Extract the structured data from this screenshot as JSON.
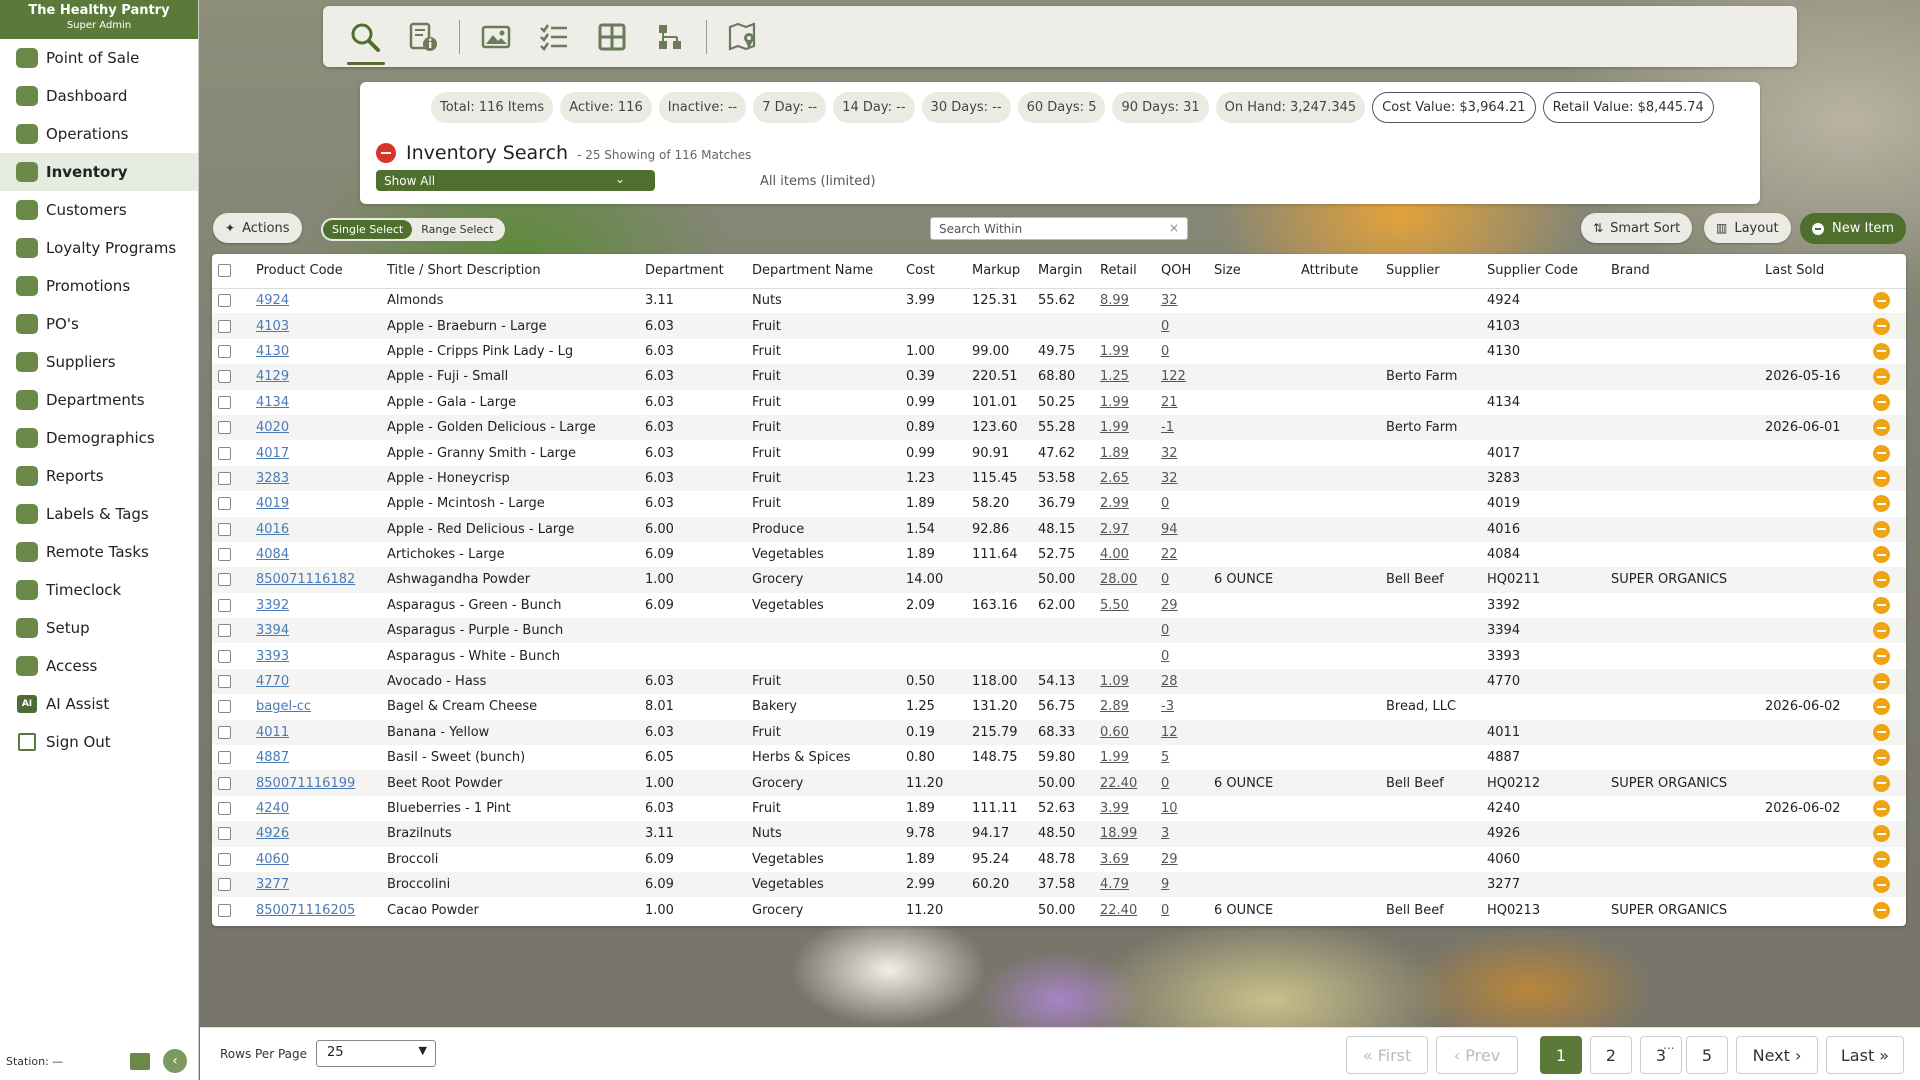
{
  "app": {
    "name": "The Healthy Pantry",
    "role": "Super Admin"
  },
  "sidebar": {
    "items": [
      {
        "label": "Point of Sale",
        "icon": "register-icon"
      },
      {
        "label": "Dashboard",
        "icon": "gauge-icon"
      },
      {
        "label": "Operations",
        "icon": "gears-icon"
      },
      {
        "label": "Inventory",
        "icon": "boxes-icon",
        "active": true
      },
      {
        "label": "Customers",
        "icon": "people-icon"
      },
      {
        "label": "Loyalty Programs",
        "icon": "badge-icon"
      },
      {
        "label": "Promotions",
        "icon": "megaphone-icon"
      },
      {
        "label": "PO's",
        "icon": "dollar-doc-icon"
      },
      {
        "label": "Suppliers",
        "icon": "truck-icon"
      },
      {
        "label": "Departments",
        "icon": "layers-icon"
      },
      {
        "label": "Demographics",
        "icon": "map-pin-icon"
      },
      {
        "label": "Reports",
        "icon": "bar-chart-icon"
      },
      {
        "label": "Labels & Tags",
        "icon": "tags-icon"
      },
      {
        "label": "Remote Tasks",
        "icon": "tablet-icon"
      },
      {
        "label": "Timeclock",
        "icon": "clock-icon"
      },
      {
        "label": "Setup",
        "icon": "sliders-icon"
      },
      {
        "label": "Access",
        "icon": "user-shield-icon"
      },
      {
        "label": "AI Assist",
        "icon": "ai-icon"
      },
      {
        "label": "Sign Out",
        "icon": "sign-out-icon"
      }
    ],
    "station": "Station: —"
  },
  "toolbar": {
    "buttons": [
      "search-icon",
      "item-info-icon",
      "image-icon",
      "checklist-icon",
      "grid-icon",
      "hierarchy-icon",
      "map-icon"
    ]
  },
  "summary": {
    "chips": [
      {
        "label": "Total: 116 Items"
      },
      {
        "label": "Active: 116"
      },
      {
        "label": "Inactive: --"
      },
      {
        "label": "7 Day: --"
      },
      {
        "label": "14 Day: --"
      },
      {
        "label": "30 Days: --"
      },
      {
        "label": "60 Days: 5"
      },
      {
        "label": "90 Days: 31"
      },
      {
        "label": "On Hand: 3,247.345"
      },
      {
        "label": "Cost Value: $3,964.21"
      },
      {
        "label": "Retail Value: $8,445.74"
      }
    ],
    "title": "Inventory Search",
    "subtitle": "- 25 Showing of 116 Matches",
    "filter_value": "Show All",
    "filter_note": "All items (limited)"
  },
  "controls": {
    "actions": "Actions",
    "single_select": "Single Select",
    "range_select": "Range Select",
    "search_placeholder": "Search Within",
    "smart_sort": "Smart Sort",
    "layout": "Layout",
    "new_item": "New Item"
  },
  "table": {
    "columns": [
      "Product Code",
      "Title / Short Description",
      "Department",
      "Department Name",
      "Cost",
      "Markup",
      "Margin",
      "Retail",
      "QOH",
      "Size",
      "Attribute",
      "Supplier",
      "Supplier Code",
      "Brand",
      "Last Sold"
    ],
    "rows": [
      [
        "4924",
        "Almonds",
        "3.11",
        "Nuts",
        "3.99",
        "125.31",
        "55.62",
        "8.99",
        "32",
        "",
        "",
        "",
        "4924",
        "",
        ""
      ],
      [
        "4103",
        "Apple - Braeburn - Large",
        "6.03",
        "Fruit",
        "",
        "",
        "",
        "",
        "0",
        "",
        "",
        "",
        "4103",
        "",
        ""
      ],
      [
        "4130",
        "Apple - Cripps Pink Lady - Lg",
        "6.03",
        "Fruit",
        "1.00",
        "99.00",
        "49.75",
        "1.99",
        "0",
        "",
        "",
        "",
        "4130",
        "",
        ""
      ],
      [
        "4129",
        "Apple - Fuji - Small",
        "6.03",
        "Fruit",
        "0.39",
        "220.51",
        "68.80",
        "1.25",
        "122",
        "",
        "",
        "Berto Farm",
        "",
        "",
        "2026-05-16"
      ],
      [
        "4134",
        "Apple - Gala - Large",
        "6.03",
        "Fruit",
        "0.99",
        "101.01",
        "50.25",
        "1.99",
        "21",
        "",
        "",
        "",
        "4134",
        "",
        ""
      ],
      [
        "4020",
        "Apple - Golden Delicious - Large",
        "6.03",
        "Fruit",
        "0.89",
        "123.60",
        "55.28",
        "1.99",
        "-1",
        "",
        "",
        "Berto Farm",
        "",
        "",
        "2026-06-01"
      ],
      [
        "4017",
        "Apple - Granny Smith - Large",
        "6.03",
        "Fruit",
        "0.99",
        "90.91",
        "47.62",
        "1.89",
        "32",
        "",
        "",
        "",
        "4017",
        "",
        ""
      ],
      [
        "3283",
        "Apple - Honeycrisp",
        "6.03",
        "Fruit",
        "1.23",
        "115.45",
        "53.58",
        "2.65",
        "32",
        "",
        "",
        "",
        "3283",
        "",
        ""
      ],
      [
        "4019",
        "Apple - Mcintosh - Large",
        "6.03",
        "Fruit",
        "1.89",
        "58.20",
        "36.79",
        "2.99",
        "0",
        "",
        "",
        "",
        "4019",
        "",
        ""
      ],
      [
        "4016",
        "Apple - Red Delicious - Large",
        "6.00",
        "Produce",
        "1.54",
        "92.86",
        "48.15",
        "2.97",
        "94",
        "",
        "",
        "",
        "4016",
        "",
        ""
      ],
      [
        "4084",
        "Artichokes - Large",
        "6.09",
        "Vegetables",
        "1.89",
        "111.64",
        "52.75",
        "4.00",
        "22",
        "",
        "",
        "",
        "4084",
        "",
        ""
      ],
      [
        "850071116182",
        "Ashwagandha Powder",
        "1.00",
        "Grocery",
        "14.00",
        "",
        "50.00",
        "28.00",
        "0",
        "6 OUNCE",
        "",
        "Bell Beef",
        "HQ0211",
        "SUPER ORGANICS",
        ""
      ],
      [
        "3392",
        "Asparagus - Green - Bunch",
        "6.09",
        "Vegetables",
        "2.09",
        "163.16",
        "62.00",
        "5.50",
        "29",
        "",
        "",
        "",
        "3392",
        "",
        ""
      ],
      [
        "3394",
        "Asparagus - Purple - Bunch",
        "",
        "",
        "",
        "",
        "",
        "",
        "0",
        "",
        "",
        "",
        "3394",
        "",
        ""
      ],
      [
        "3393",
        "Asparagus - White - Bunch",
        "",
        "",
        "",
        "",
        "",
        "",
        "0",
        "",
        "",
        "",
        "3393",
        "",
        ""
      ],
      [
        "4770",
        "Avocado - Hass",
        "6.03",
        "Fruit",
        "0.50",
        "118.00",
        "54.13",
        "1.09",
        "28",
        "",
        "",
        "",
        "4770",
        "",
        ""
      ],
      [
        "bagel-cc",
        "Bagel & Cream Cheese",
        "8.01",
        "Bakery",
        "1.25",
        "131.20",
        "56.75",
        "2.89",
        "-3",
        "",
        "",
        "Bread, LLC",
        "",
        "",
        "2026-06-02"
      ],
      [
        "4011",
        "Banana - Yellow",
        "6.03",
        "Fruit",
        "0.19",
        "215.79",
        "68.33",
        "0.60",
        "12",
        "",
        "",
        "",
        "4011",
        "",
        ""
      ],
      [
        "4887",
        "Basil - Sweet (bunch)",
        "6.05",
        "Herbs & Spices",
        "0.80",
        "148.75",
        "59.80",
        "1.99",
        "5",
        "",
        "",
        "",
        "4887",
        "",
        ""
      ],
      [
        "850071116199",
        "Beet Root Powder",
        "1.00",
        "Grocery",
        "11.20",
        "",
        "50.00",
        "22.40",
        "0",
        "6 OUNCE",
        "",
        "Bell Beef",
        "HQ0212",
        "SUPER ORGANICS",
        ""
      ],
      [
        "4240",
        "Blueberries - 1 Pint",
        "6.03",
        "Fruit",
        "1.89",
        "111.11",
        "52.63",
        "3.99",
        "10",
        "",
        "",
        "",
        "4240",
        "",
        "2026-06-02"
      ],
      [
        "4926",
        "Brazilnuts",
        "3.11",
        "Nuts",
        "9.78",
        "94.17",
        "48.50",
        "18.99",
        "3",
        "",
        "",
        "",
        "4926",
        "",
        ""
      ],
      [
        "4060",
        "Broccoli",
        "6.09",
        "Vegetables",
        "1.89",
        "95.24",
        "48.78",
        "3.69",
        "29",
        "",
        "",
        "",
        "4060",
        "",
        ""
      ],
      [
        "3277",
        "Broccolini",
        "6.09",
        "Vegetables",
        "2.99",
        "60.20",
        "37.58",
        "4.79",
        "9",
        "",
        "",
        "",
        "3277",
        "",
        ""
      ],
      [
        "850071116205",
        "Cacao Powder",
        "1.00",
        "Grocery",
        "11.20",
        "",
        "50.00",
        "22.40",
        "0",
        "6 OUNCE",
        "",
        "Bell Beef",
        "HQ0213",
        "SUPER ORGANICS",
        ""
      ]
    ]
  },
  "footer": {
    "rows_per_page_label": "Rows Per Page",
    "rows_per_page_value": "25",
    "first": "« First",
    "prev": "‹ Prev",
    "pages": [
      "1",
      "2",
      "3",
      "5"
    ],
    "ellipsis": "...",
    "next": "Next ›",
    "last": "Last »",
    "current_page": "1"
  },
  "colors": {
    "brand": "#5b7a3a",
    "accent_orange": "#f0a412",
    "danger": "#d9342b",
    "link": "#4a7bb7"
  }
}
